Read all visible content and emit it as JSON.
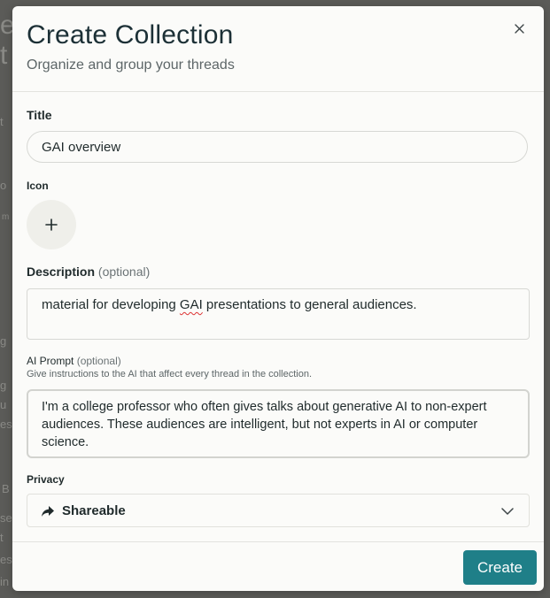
{
  "background_fragments": [
    "e",
    "t",
    "t",
    "o",
    "m",
    "g",
    "g",
    "u",
    "es",
    "B",
    "se",
    "t",
    "es",
    "in"
  ],
  "modal": {
    "title": "Create Collection",
    "subtitle": "Organize and group your threads",
    "close_icon": "close-icon"
  },
  "form": {
    "title_label": "Title",
    "title_value": "GAI overview",
    "icon_label": "Icon",
    "icon_picker_symbol": "+",
    "description_label": "Description",
    "description_optional": "(optional)",
    "description_before": "material for developing ",
    "description_flagged_word": "GAI",
    "description_after": " presentations to general audiences.",
    "ai_prompt_label": "AI Prompt",
    "ai_prompt_optional": "(optional)",
    "ai_prompt_helper": "Give instructions to the AI that affect every thread in the collection.",
    "ai_prompt_value": "I'm a college professor who often gives talks about generative AI to non-expert audiences. These audiences are intelligent, but not experts in AI or computer science.",
    "privacy_label": "Privacy",
    "privacy_value": "Shareable",
    "privacy_icon": "share-arrow-icon",
    "privacy_dropdown_icon": "chevron-down-icon"
  },
  "footer": {
    "create_label": "Create"
  },
  "colors": {
    "accent": "#1f7f88",
    "modal_bg": "#fbfbf9",
    "text": "#1f2a2b",
    "muted": "#5d6668",
    "overlay": "#3a3a38"
  }
}
